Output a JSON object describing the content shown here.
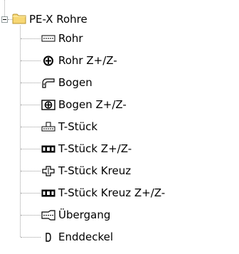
{
  "tree": {
    "root": {
      "label": "PE-X Rohre",
      "icon": "folder-icon",
      "expanded": true,
      "folder_color": "#f7d774"
    },
    "children": [
      {
        "label": "Rohr",
        "icon": "pipe-icon"
      },
      {
        "label": "Rohr Z+/Z-",
        "icon": "pipe-tolerance-icon"
      },
      {
        "label": "Bogen",
        "icon": "elbow-icon"
      },
      {
        "label": "Bogen Z+/Z-",
        "icon": "elbow-tolerance-icon"
      },
      {
        "label": "T-Stück",
        "icon": "tee-icon"
      },
      {
        "label": "T-Stück Z+/Z-",
        "icon": "tee-tolerance-icon"
      },
      {
        "label": "T-Stück Kreuz",
        "icon": "cross-tee-icon"
      },
      {
        "label": "T-Stück Kreuz Z+/Z-",
        "icon": "cross-tee-tolerance-icon"
      },
      {
        "label": "Übergang",
        "icon": "transition-icon"
      },
      {
        "label": "Enddeckel",
        "icon": "end-cap-icon"
      }
    ]
  }
}
